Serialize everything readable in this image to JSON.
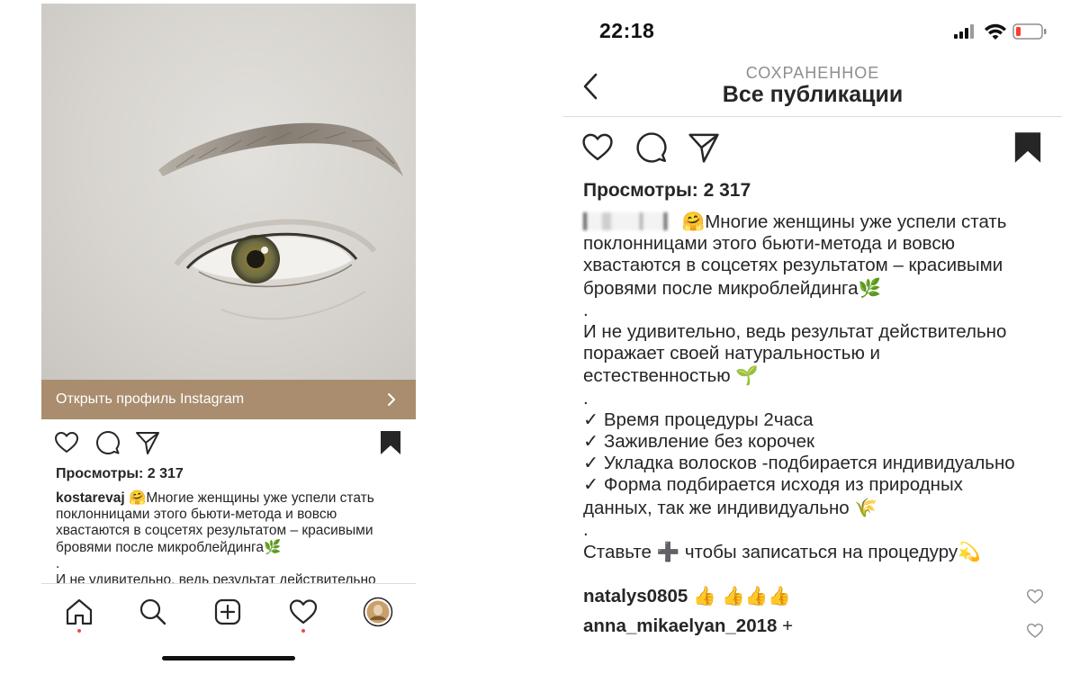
{
  "left_phone": {
    "profile_bar_label": "Открыть профиль Instagram",
    "views": "Просмотры: 2 317",
    "username": "kostarevaj",
    "caption_line1": "Многие женщины уже успели стать",
    "caption_line2": "поклонницами этого бьюти-метода и вовсю",
    "caption_line3": "хвастаются в соцсетях результатом – красивыми",
    "caption_line4": "бровями после микроблейдинга",
    "caption_dot": ".",
    "caption_line5": "И не удивительно, ведь результат действительно",
    "emoji_smile": "🤗",
    "emoji_herb": "🌿",
    "tabs": [
      "home-icon",
      "search-icon",
      "new-post-icon",
      "activity-heart-icon",
      "profile-avatar-icon"
    ]
  },
  "right_phone": {
    "status_time": "22:18",
    "nav_subtitle": "СОХРАНЕННОЕ",
    "nav_title": "Все публикации",
    "views": "Просмотры: 2 317",
    "caption": {
      "emoji_smile": "🤗",
      "p1_line1": "Многие женщины уже успели стать",
      "p1_line2": "поклонницами этого бьюти-метода и вовсю",
      "p1_line3": "хвастаются в соцсетях результатом – красивыми",
      "p1_line4": "бровями после микроблейдинга",
      "emoji_herb": "🌿",
      "dot1": ".",
      "p2_line1": "И не удивительно, ведь результат действительно",
      "p2_line2": "поражает своей натуральностью и",
      "p2_line3": "естественностью",
      "emoji_seedling": "🌱",
      "dot2": ".",
      "li1": "✓ Время процедуры 2часа",
      "li2": "✓ Заживление без корочек",
      "li3": "✓ Укладка волосков -подбирается индивидуально",
      "li4a": "✓ Форма подбирается исходя из природных",
      "li4b": "данных, так же индивидуально",
      "emoji_rice": "🌾",
      "dot3": ".",
      "cta_a": "Ставьте",
      "emoji_plus": "➕",
      "cta_b": "чтобы записаться на процедуру",
      "emoji_dizzy": "💫"
    },
    "comments": [
      {
        "user": "natalys0805",
        "text": "👍 👍👍👍"
      },
      {
        "user": "anna_mikaelyan_2018",
        "text": "+"
      }
    ]
  },
  "colors": {
    "profile_bar": "#a98d6e",
    "notification_dot": "#ed4956",
    "battery_low": "#ff3b30"
  }
}
